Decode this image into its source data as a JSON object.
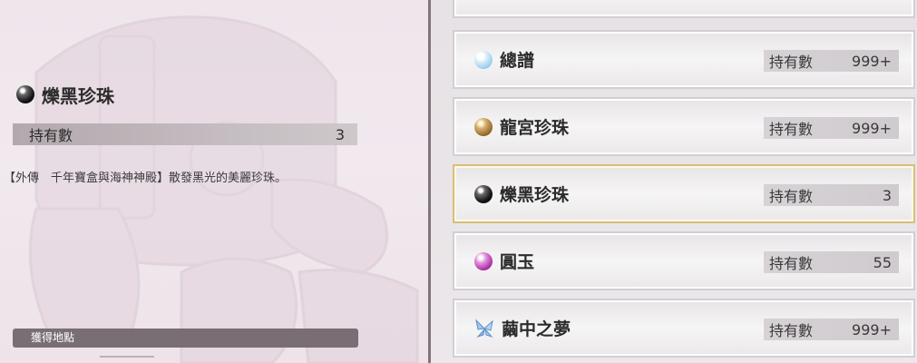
{
  "detail": {
    "item_name": "爍黑珍珠",
    "item_icon": "black-pearl-icon",
    "owned_label": "持有數",
    "owned_count": "3",
    "description": "【外傳　千年寶盒與海神神殿】散發黑光的美麗珍珠。",
    "location_label": "獲得地點"
  },
  "list": {
    "items": [
      {
        "name": "總譜",
        "icon": "sheet-music-orb-icon",
        "count_label": "持有數",
        "count": "999+"
      },
      {
        "name": "龍宮珍珠",
        "icon": "gold-pearl-icon",
        "count_label": "持有數",
        "count": "999+"
      },
      {
        "name": "爍黑珍珠",
        "icon": "black-pearl-icon",
        "count_label": "持有數",
        "count": "3",
        "selected": true
      },
      {
        "name": "圓玉",
        "icon": "purple-orb-icon",
        "count_label": "持有數",
        "count": "55"
      },
      {
        "name": "繭中之夢",
        "icon": "butterfly-crystal-icon",
        "count_label": "持有數",
        "count": "999+"
      }
    ]
  },
  "colors": {
    "selected_border": "#d8bf7a",
    "location_bar": "#786e74",
    "divider": "#80757c"
  }
}
